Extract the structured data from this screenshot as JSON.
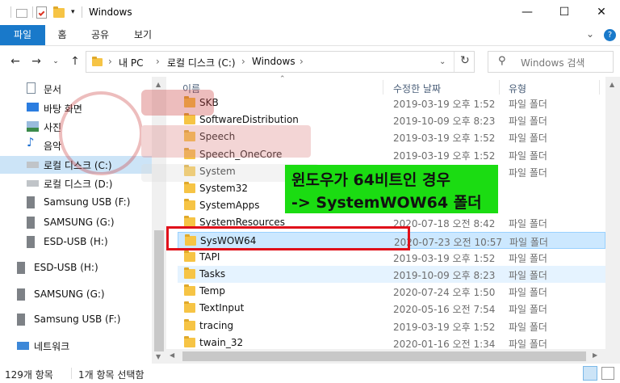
{
  "window": {
    "title": "Windows"
  },
  "ribbon": {
    "tabs": [
      "파일",
      "홈",
      "공유",
      "보기"
    ]
  },
  "address": {
    "segments": [
      "내 PC",
      "로컬 디스크 (C:)",
      "Windows"
    ]
  },
  "search": {
    "placeholder": "Windows 검색"
  },
  "sidebar": {
    "items": [
      {
        "label": "문서",
        "icon": "document-icon"
      },
      {
        "label": "바탕 화면",
        "icon": "desktop-icon"
      },
      {
        "label": "사진",
        "icon": "pictures-icon"
      },
      {
        "label": "음악",
        "icon": "music-icon"
      },
      {
        "label": "로컬 디스크 (C:)",
        "icon": "drive-icon",
        "selected": true
      },
      {
        "label": "로컬 디스크 (D:)",
        "icon": "drive-icon"
      },
      {
        "label": "Samsung USB (F:)",
        "icon": "usb-drive-icon"
      },
      {
        "label": "SAMSUNG (G:)",
        "icon": "usb-drive-icon"
      },
      {
        "label": "ESD-USB (H:)",
        "icon": "usb-drive-icon"
      },
      {
        "label": "ESD-USB (H:)",
        "icon": "usb-drive-icon"
      },
      {
        "label": "SAMSUNG (G:)",
        "icon": "usb-drive-icon"
      },
      {
        "label": "Samsung USB (F:)",
        "icon": "usb-drive-icon"
      },
      {
        "label": "네트워크",
        "icon": "network-icon"
      }
    ]
  },
  "list": {
    "columns": {
      "name": "이름",
      "date": "수정한 날짜",
      "type": "유형"
    },
    "rows": [
      {
        "name": "SKB",
        "date": "2019-03-19 오후 1:52",
        "type": "파일 폴더"
      },
      {
        "name": "SoftwareDistribution",
        "date": "2019-10-09 오후 8:23",
        "type": "파일 폴더"
      },
      {
        "name": "Speech",
        "date": "2019-03-19 오후 1:52",
        "type": "파일 폴더"
      },
      {
        "name": "Speech_OneCore",
        "date": "2019-03-19 오후 1:52",
        "type": "파일 폴더"
      },
      {
        "name": "System",
        "date": "2019-03-19 오후 1:52",
        "type": "파일 폴더"
      },
      {
        "name": "System32",
        "date": "",
        "type": ""
      },
      {
        "name": "SystemApps",
        "date": "",
        "type": ""
      },
      {
        "name": "SystemResources",
        "date": "2020-07-18 오전 8:42",
        "type": "파일 폴더"
      },
      {
        "name": "SysWOW64",
        "date": "2020-07-23 오전 10:57",
        "type": "파일 폴더",
        "selected": true
      },
      {
        "name": "TAPI",
        "date": "2019-03-19 오후 1:52",
        "type": "파일 폴더"
      },
      {
        "name": "Tasks",
        "date": "2019-10-09 오후 8:23",
        "type": "파일 폴더",
        "hover": true
      },
      {
        "name": "Temp",
        "date": "2020-07-24 오후 1:50",
        "type": "파일 폴더"
      },
      {
        "name": "TextInput",
        "date": "2020-05-16 오전 7:54",
        "type": "파일 폴더"
      },
      {
        "name": "tracing",
        "date": "2019-03-19 오후 1:52",
        "type": "파일 폴더"
      },
      {
        "name": "twain_32",
        "date": "2020-01-16 오전 1:34",
        "type": "파일 폴더"
      }
    ]
  },
  "status": {
    "count": "129개 항목",
    "selection": "1개 항목 선택함"
  },
  "annotation": {
    "line1": "윈도우가 64비트인 경우",
    "line2": "-> SystemWOW64 폴더"
  },
  "colors": {
    "accent": "#1979ca",
    "annotation_bg": "#1bdc12",
    "highlight_border": "#e0101a",
    "folder": "#f6c445"
  }
}
